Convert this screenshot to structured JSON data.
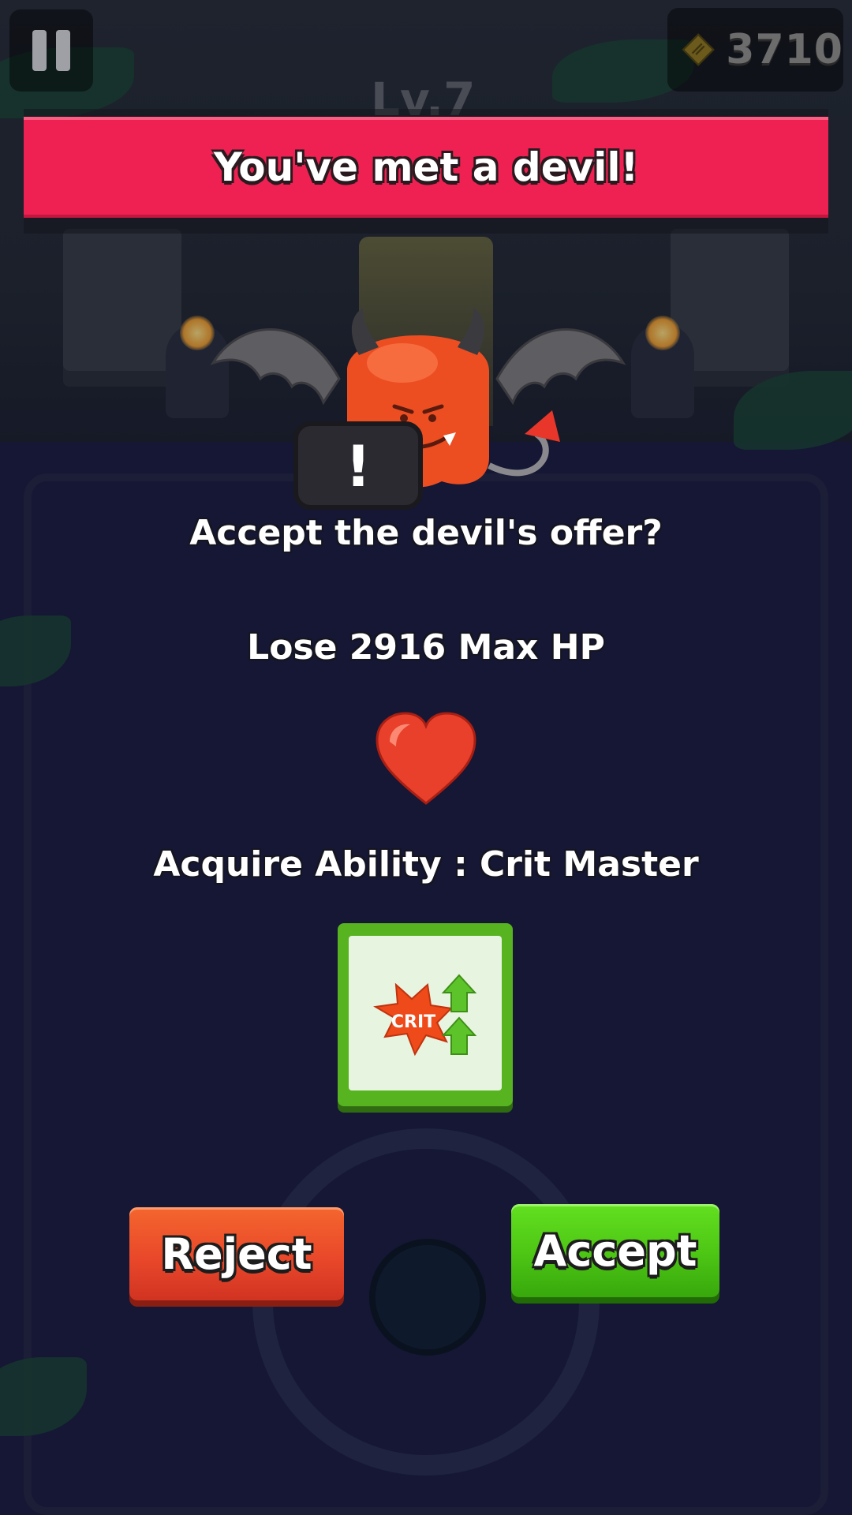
{
  "hud": {
    "coins": "3710",
    "level": "Lv.7",
    "pause_icon": "pause-icon",
    "coin_icon": "coin-icon"
  },
  "banner": {
    "title": "You've met a devil!",
    "color": "#ee2152"
  },
  "devil": {
    "icon": "devil-icon",
    "speech_mark": "!"
  },
  "offer": {
    "question": "Accept the devil's offer?",
    "cost": "Lose 2916 Max HP",
    "cost_icon": "heart-icon",
    "reward": "Acquire Ability : Crit Master",
    "reward_icon": "crit-master-icon",
    "reward_icon_label": "CRIT"
  },
  "actions": {
    "reject_label": "Reject",
    "accept_label": "Accept",
    "reject_color": "#e9482a",
    "accept_color": "#4cc514"
  }
}
